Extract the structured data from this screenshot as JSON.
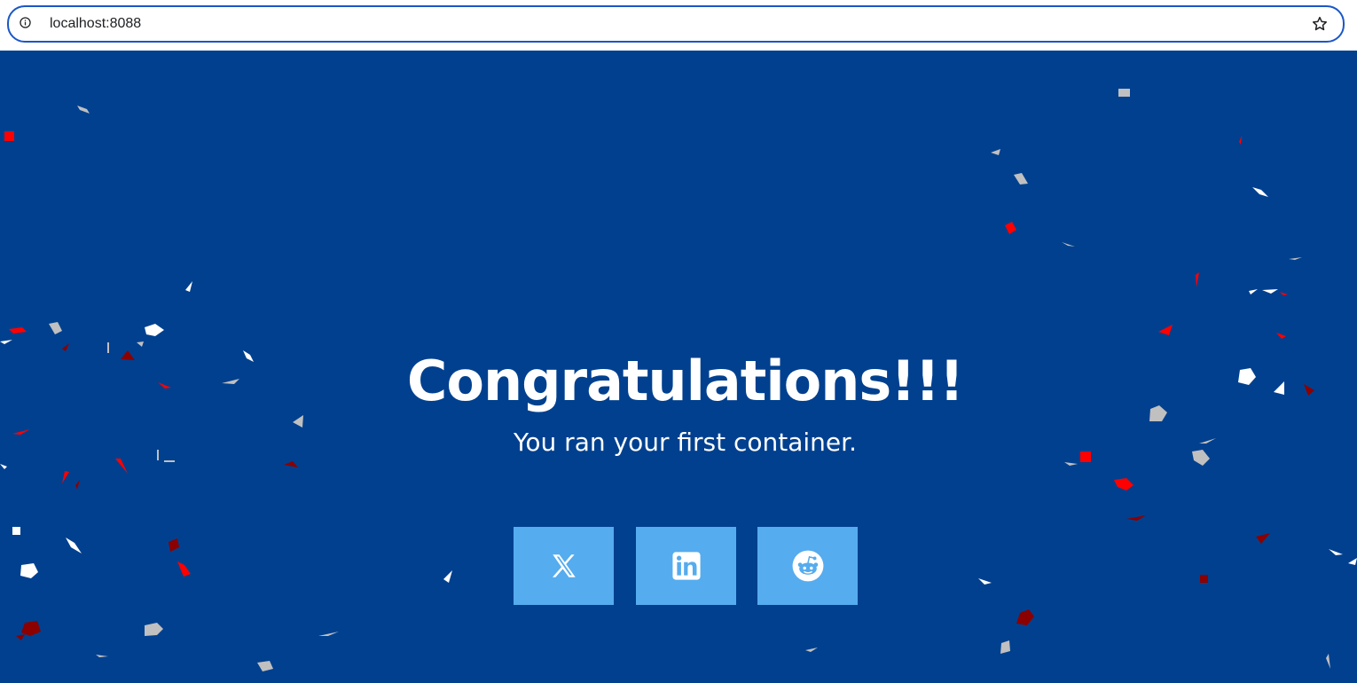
{
  "browser": {
    "url": "localhost:8088"
  },
  "page": {
    "title": "Congratulations!!!",
    "subtitle": "You ran your first container."
  },
  "share_buttons": [
    {
      "icon": "x-twitter-icon"
    },
    {
      "icon": "linkedin-icon"
    },
    {
      "icon": "reddit-icon"
    }
  ],
  "colors": {
    "background": "#00408f",
    "button": "#55acee",
    "text": "#ffffff",
    "confetti": [
      "#ff0000",
      "#8b0000",
      "#ffffff",
      "#c0c0c0"
    ]
  }
}
